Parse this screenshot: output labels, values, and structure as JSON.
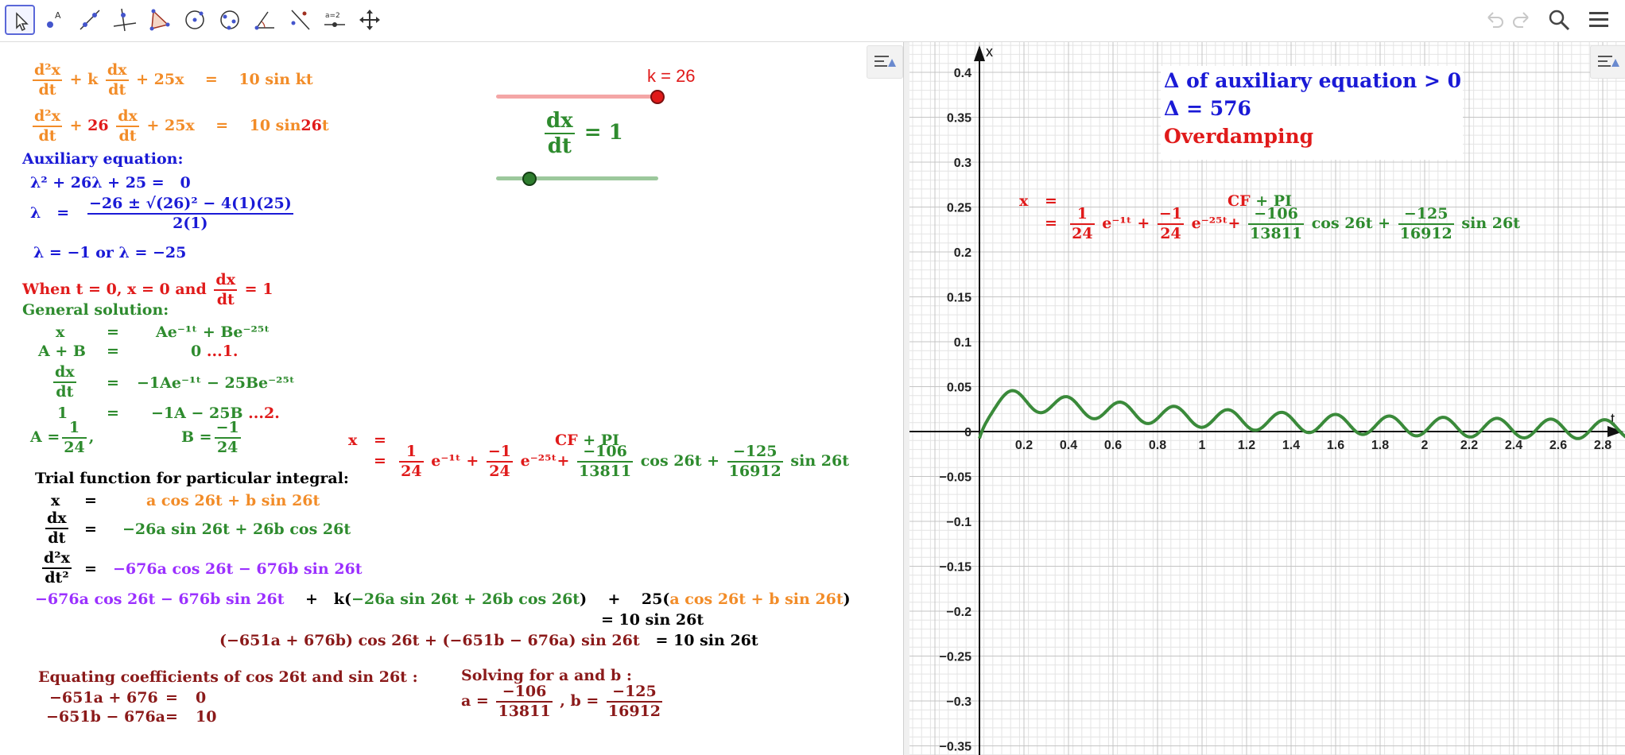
{
  "toolbar": {
    "tools": [
      "move-tool",
      "point-tool",
      "line-tool",
      "perpendicular-line-tool",
      "polygon-tool",
      "circle-center-tool",
      "circle-three-points-tool",
      "angle-tool",
      "reflect-tool",
      "slider-tool",
      "move-graphics-tool"
    ],
    "slider_tool_label": "a=2"
  },
  "slider_k": {
    "label": "k = 26",
    "value": 26
  },
  "slider_v": {
    "lhs_num": "dx",
    "lhs_den": "dt",
    "rhs": "= 1"
  },
  "algebra": {
    "eq1": {
      "num": "d²x",
      "den": "dt",
      "plus_k": "+ k",
      "dx": "dx",
      "dt": "dt",
      "rest": "+ 25x",
      "eq": "=",
      "rhs": "10 sin kt"
    },
    "eq2": {
      "num": "d²x",
      "den": "dt",
      "plus": "+",
      "k": "26",
      "dx": "dx",
      "dt": "dt",
      "rest": "+ 25x",
      "eq": "=",
      "rhs_a": "10 sin",
      "rhs_b": "26",
      "rhs_c": "t"
    },
    "aux_title": "Auxiliary equation:",
    "aux1_lhs": "λ² + 26λ + 25 =",
    "aux1_rhs": "0",
    "aux2_lhs": "λ",
    "aux2_eq": "=",
    "aux2_num": "−26 ± √(26)² − 4(1)(25)",
    "aux2_den": "2(1)",
    "aux3": "λ = −1 or λ = −25",
    "when_text": "When t = 0,  x = 0 and",
    "when_num": "dx",
    "when_den": "dt",
    "when_rhs": "= 1",
    "gen_title": "General solution:",
    "g1_lhs": "x",
    "g1_eq": "=",
    "g1_rhs": "Ae⁻¹ᵗ + Be⁻²⁵ᵗ",
    "g2_lhs": "A + B",
    "g2_eq": "=",
    "g2_rhs": "0",
    "g2_tag": "...1.",
    "g3_num": "dx",
    "g3_den": "dt",
    "g3_eq": "=",
    "g3_rhs": "−1Ae⁻¹ᵗ − 25Be⁻²⁵ᵗ",
    "g4_lhs": "1",
    "g4_eq": "=",
    "g4_rhs": "−1A − 25B",
    "g4_tag": "...2.",
    "A_lhs": "A =",
    "A_num": "1",
    "A_den": "24",
    "A_comma": ",",
    "B_lhs": "B =",
    "B_num": "−1",
    "B_den": "24",
    "x_lhs": "x",
    "x_eq": "=",
    "x_cf": "CF",
    "x_pi": "+ PI",
    "xs_eq": "=",
    "xs_f1n": "1",
    "xs_f1d": "24",
    "xs_e1": "e⁻¹ᵗ +",
    "xs_f2n": "−1",
    "xs_f2d": "24",
    "xs_e2": "e⁻²⁵ᵗ+",
    "xs_f3n": "−106",
    "xs_f3d": "13811",
    "xs_c": "cos 26t +",
    "xs_f4n": "−125",
    "xs_f4d": "16912",
    "xs_s": "sin 26t",
    "trial_title": "Trial function for particular integral:",
    "t1_lhs": "x",
    "t1_eq": "=",
    "t1_rhs": "a cos 26t + b sin 26t",
    "t2_num": "dx",
    "t2_den": "dt",
    "t2_eq": "=",
    "t2_rhs": "−26a sin 26t + 26b cos 26t",
    "t3_num": "d²x",
    "t3_den": "dt²",
    "t3_eq": "=",
    "t3_rhs": "−676a cos 26t − 676b sin 26t",
    "sub_a": "−676a cos 26t − 676b sin 26t",
    "sub_plus1": "+",
    "sub_k": "k(",
    "sub_b": "−26a sin 26t + 26b cos 26t",
    "sub_close1": ")",
    "sub_plus2": "+",
    "sub_25": "25(",
    "sub_c": "a cos 26t + b sin 26t",
    "sub_close2": ")",
    "sub_rhs": "= 10 sin 26t",
    "collect": "(−651a + 676b) cos 26t + (−651b − 676a) sin 26t",
    "collect_rhs": "= 10 sin 26t",
    "eqc_title": "Equating coefficients of cos 26t and sin 26t :",
    "eqc1_lhs": "−651a + 676",
    "eqc1_eq": "=",
    "eqc1_rhs": "0",
    "eqc2_lhs": "−651b − 676a",
    "eqc2_eq": "=",
    "eqc2_rhs": "10",
    "solve_title": "Solving for a and b :",
    "solve_a": "a =",
    "solve_an": "−106",
    "solve_ad": "13811",
    "solve_b": ", b =",
    "solve_bn": "−125",
    "solve_bd": "16912"
  },
  "graphics": {
    "info_line1": "Δ of auxiliary equation > 0",
    "info_line2": "Δ = 576",
    "info_line3": "Overdamping",
    "x_axis_label": "t",
    "y_axis_label": "x",
    "curve_color": "#3a8a3a",
    "accent_blue": "#1a1ad6",
    "accent_red": "#e01a1a",
    "x_ticks": [
      "0.2",
      "0.4",
      "0.6",
      "0.8",
      "1",
      "1.2",
      "1.4",
      "1.6",
      "1.8",
      "2",
      "2.2",
      "2.4",
      "2.6",
      "2.8"
    ],
    "y_ticks": [
      "0.4",
      "0.35",
      "0.3",
      "0.25",
      "0.2",
      "0.15",
      "0.1",
      "0.05",
      "0",
      "−0.05",
      "−0.1",
      "−0.15",
      "−0.2",
      "−0.25",
      "−0.3",
      "−0.35"
    ]
  },
  "chart_data": {
    "type": "line",
    "function": "x(t) = (1/24)e^(-t) − (1/24)e^(-25t) − (106/13811)cos 26t − (125/16912)sin 26t",
    "xlabel": "t",
    "ylabel": "x",
    "xlim": [
      0,
      2.9
    ],
    "ylim": [
      -0.36,
      0.42
    ],
    "grid": true
  }
}
